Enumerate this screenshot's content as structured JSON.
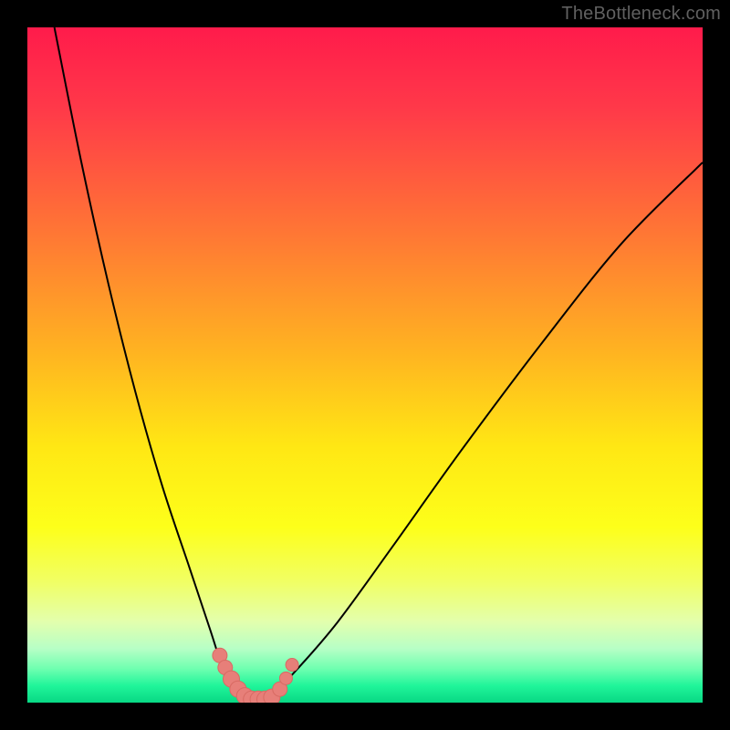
{
  "watermark": "TheBottleneck.com",
  "colors": {
    "frame": "#000000",
    "curve": "#000000",
    "marker_fill": "#e77f79",
    "marker_stroke": "#d86a63",
    "gradient_stops": [
      {
        "offset": 0,
        "color": "#ff1b4b"
      },
      {
        "offset": 0.12,
        "color": "#ff3949"
      },
      {
        "offset": 0.3,
        "color": "#ff7535"
      },
      {
        "offset": 0.48,
        "color": "#ffb321"
      },
      {
        "offset": 0.62,
        "color": "#ffe714"
      },
      {
        "offset": 0.74,
        "color": "#fdff1a"
      },
      {
        "offset": 0.82,
        "color": "#f1ff63"
      },
      {
        "offset": 0.88,
        "color": "#e3ffad"
      },
      {
        "offset": 0.92,
        "color": "#b7ffc6"
      },
      {
        "offset": 0.95,
        "color": "#6effb0"
      },
      {
        "offset": 0.975,
        "color": "#20f59a"
      },
      {
        "offset": 1.0,
        "color": "#08d884"
      }
    ]
  },
  "chart_data": {
    "type": "line",
    "title": "",
    "xlabel": "",
    "ylabel": "",
    "xlim": [
      0,
      100
    ],
    "ylim": [
      0,
      100
    ],
    "note": "V-shaped bottleneck curve; y≈100 at edges, y≈0 near x≈33. Values are visual estimates.",
    "series": [
      {
        "name": "left-branch",
        "x": [
          4,
          8,
          12,
          16,
          20,
          24,
          27,
          29,
          31,
          33
        ],
        "y": [
          100,
          80,
          62,
          46,
          32,
          20,
          11,
          5,
          1,
          0
        ]
      },
      {
        "name": "right-branch",
        "x": [
          33,
          36,
          40,
          46,
          54,
          64,
          76,
          88,
          100
        ],
        "y": [
          0,
          1,
          5,
          12,
          23,
          37,
          53,
          68,
          80
        ]
      }
    ],
    "markers": {
      "name": "highlighted-points",
      "x": [
        28.5,
        29.3,
        30.2,
        31.2,
        32.2,
        33.2,
        34.2,
        35.2,
        36.2,
        37.4,
        38.3,
        39.2
      ],
      "y": [
        7.0,
        5.2,
        3.5,
        2.0,
        1.0,
        0.5,
        0.5,
        0.5,
        0.8,
        2.0,
        3.6,
        5.6
      ],
      "r": [
        8,
        8,
        9,
        9,
        9,
        9,
        9,
        9,
        9,
        8,
        7,
        7
      ]
    }
  }
}
